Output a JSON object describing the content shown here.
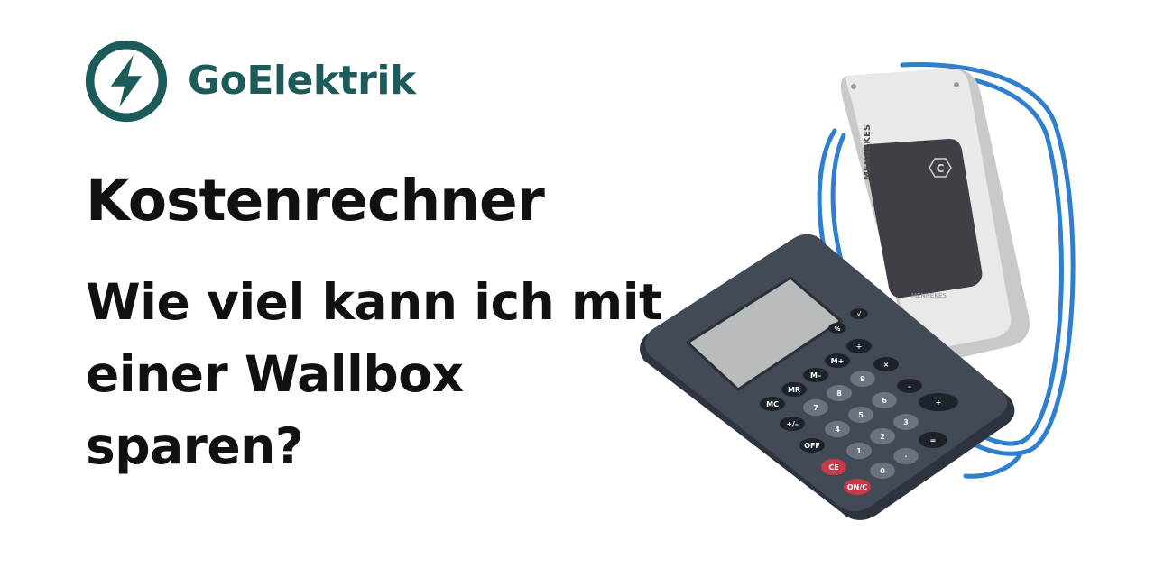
{
  "brand": {
    "name": "GoElektrik",
    "icon": "lightning-bolt-icon",
    "color": "#1d5b5b"
  },
  "headline": "Kostenrechner",
  "subheadline": "Wie viel kann ich mit einer Wallbox sparen?",
  "illustration": {
    "wallbox_brand": "MENNEKES",
    "wallbox_badge": "C",
    "wallbox_footer": "MENNEKES",
    "calculator_keys": [
      [
        "MC",
        "MR",
        "M–",
        "M+",
        "÷"
      ],
      [
        "+/–",
        "7",
        "8",
        "9",
        "×"
      ],
      [
        "OFF",
        "4",
        "5",
        "6",
        "–"
      ],
      [
        "CE",
        "1",
        "2",
        "3",
        "+"
      ],
      [
        "ON/C",
        "0",
        "·",
        "="
      ],
      [
        "%",
        "√"
      ]
    ]
  }
}
